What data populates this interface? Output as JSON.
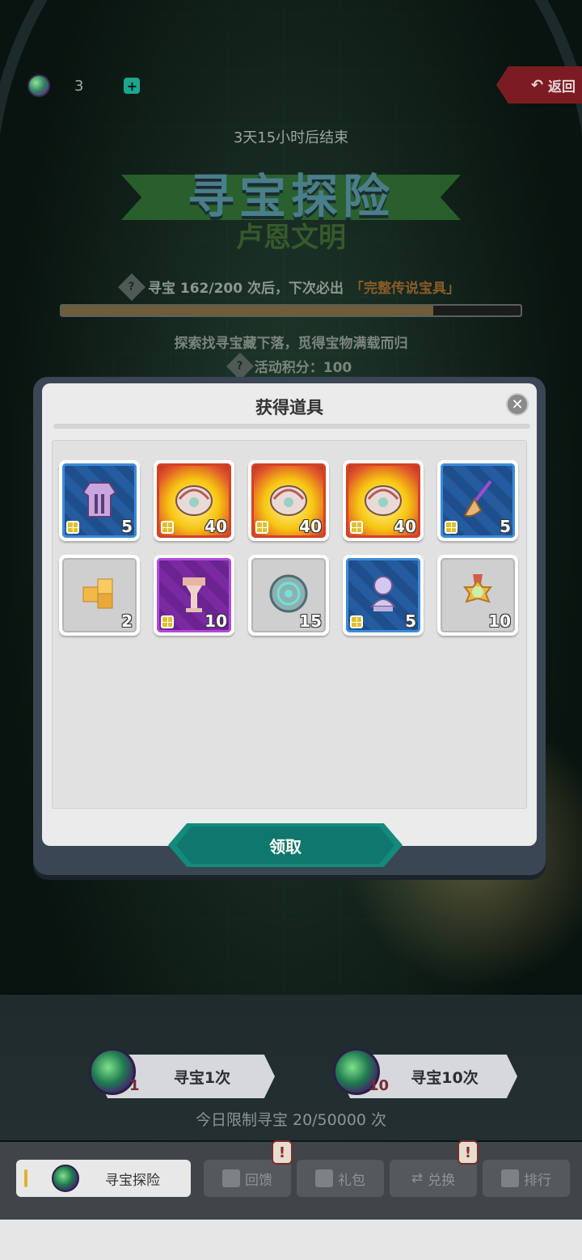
{
  "top": {
    "currency_count": "3",
    "back_label": "返回"
  },
  "event": {
    "timer": "3天15小时后结束",
    "title": "寻宝探险",
    "subtitle": "卢恩文明",
    "progress_prefix": "寻宝 162/200 次后，下次必出",
    "progress_highlight": "「完整传说宝具」",
    "progress_fraction": 0.81,
    "description": "探索找寻宝藏下落，觅得宝物满载而归",
    "score_text": "活动积分：100"
  },
  "modal": {
    "title": "获得道具",
    "claim_label": "领取",
    "items": [
      {
        "rarity": "blue",
        "icon": "robe-icon",
        "count": "5",
        "fragment": true
      },
      {
        "rarity": "gold",
        "icon": "legendary-helmet-icon",
        "count": "40",
        "fragment": true
      },
      {
        "rarity": "gold",
        "icon": "legendary-helmet-icon",
        "count": "40",
        "fragment": true
      },
      {
        "rarity": "gold",
        "icon": "legendary-helmet-icon",
        "count": "40",
        "fragment": true
      },
      {
        "rarity": "blue",
        "icon": "broom-icon",
        "count": "5",
        "fragment": true
      },
      {
        "rarity": "gray",
        "icon": "gold-cubes-icon",
        "count": "2",
        "fragment": false
      },
      {
        "rarity": "purple",
        "icon": "pedestal-icon",
        "count": "10",
        "fragment": true
      },
      {
        "rarity": "gray",
        "icon": "swirl-coin-icon",
        "count": "15",
        "fragment": false
      },
      {
        "rarity": "blue",
        "icon": "bust-statue-icon",
        "count": "5",
        "fragment": true
      },
      {
        "rarity": "gray",
        "icon": "medal-icon",
        "count": "10",
        "fragment": false
      }
    ]
  },
  "hunt": {
    "once_label": "寻宝1次",
    "once_cost": "1",
    "ten_label": "寻宝10次",
    "ten_cost": "10",
    "daily_limit": "今日限制寻宝 20/50000 次"
  },
  "tabs": [
    {
      "label": "寻宝探险",
      "active": true
    },
    {
      "label": "回馈",
      "alert": true
    },
    {
      "label": "礼包"
    },
    {
      "label": "兑换",
      "alert": true
    },
    {
      "label": "排行"
    }
  ],
  "colors": {
    "accent_teal": "#138a7c",
    "alert_red": "#7a2c2c",
    "highlight": "#8a5c28"
  }
}
